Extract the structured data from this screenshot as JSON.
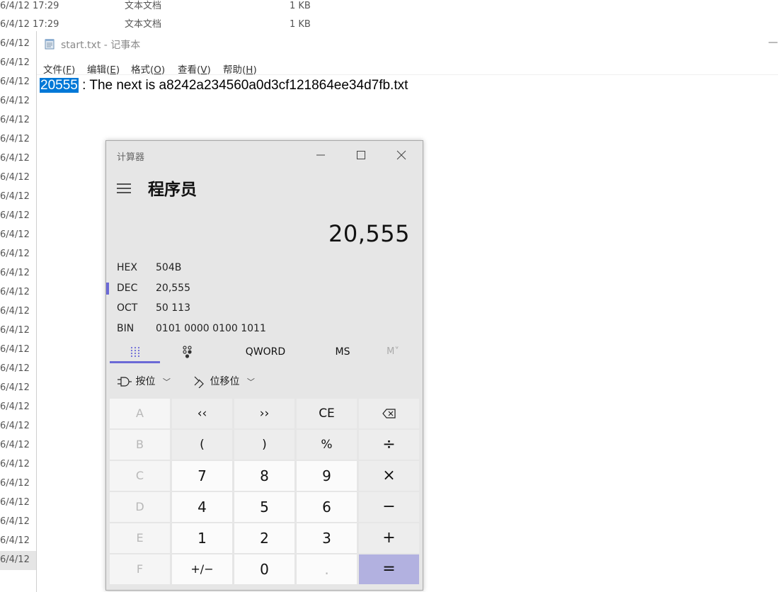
{
  "explorer": {
    "rows": [
      {
        "date": "6/4/12 17:29",
        "type": "文本文档",
        "size": "1 KB"
      },
      {
        "date": "6/4/12 17:29",
        "type": "文本文档",
        "size": "1 KB"
      }
    ],
    "truncated_date": "6/4/12"
  },
  "notepad": {
    "title": "start.txt - 记事本",
    "menu": [
      {
        "label": "文件(",
        "key": "F",
        "end": ")"
      },
      {
        "label": "编辑(",
        "key": "E",
        "end": ")"
      },
      {
        "label": "格式(",
        "key": "O",
        "end": ")"
      },
      {
        "label": "查看(",
        "key": "V",
        "end": ")"
      },
      {
        "label": "帮助(",
        "key": "H",
        "end": ")"
      }
    ],
    "selected_text": "20555",
    "rest_text": " : The next is a8242a234560a0d3cf121864ee34d7fb.txt"
  },
  "calculator": {
    "title": "计算器",
    "mode": "程序员",
    "display": "20,555",
    "bases": [
      {
        "label": "HEX",
        "value": "504B",
        "active": false
      },
      {
        "label": "DEC",
        "value": "20,555",
        "active": true
      },
      {
        "label": "OCT",
        "value": "50 113",
        "active": false
      },
      {
        "label": "BIN",
        "value": "0101 0000 0100 1011",
        "active": false
      }
    ],
    "tabs": {
      "word_size": "QWORD",
      "memory_store": "MS",
      "memory_more": "M˅"
    },
    "bitops": {
      "bitwise": "按位",
      "bitshift": "位移位"
    },
    "keys": [
      [
        "A",
        "‹‹",
        "››",
        "CE",
        "⌫"
      ],
      [
        "B",
        "(",
        ")",
        "%",
        "÷"
      ],
      [
        "C",
        "7",
        "8",
        "9",
        "×"
      ],
      [
        "D",
        "4",
        "5",
        "6",
        "−"
      ],
      [
        "E",
        "1",
        "2",
        "3",
        "+"
      ],
      [
        "F",
        "+/−",
        "0",
        ".",
        "="
      ]
    ]
  },
  "colors": {
    "accent": "#6b69d6",
    "selection": "#0078d7",
    "equals_key": "#b2b1e0"
  }
}
